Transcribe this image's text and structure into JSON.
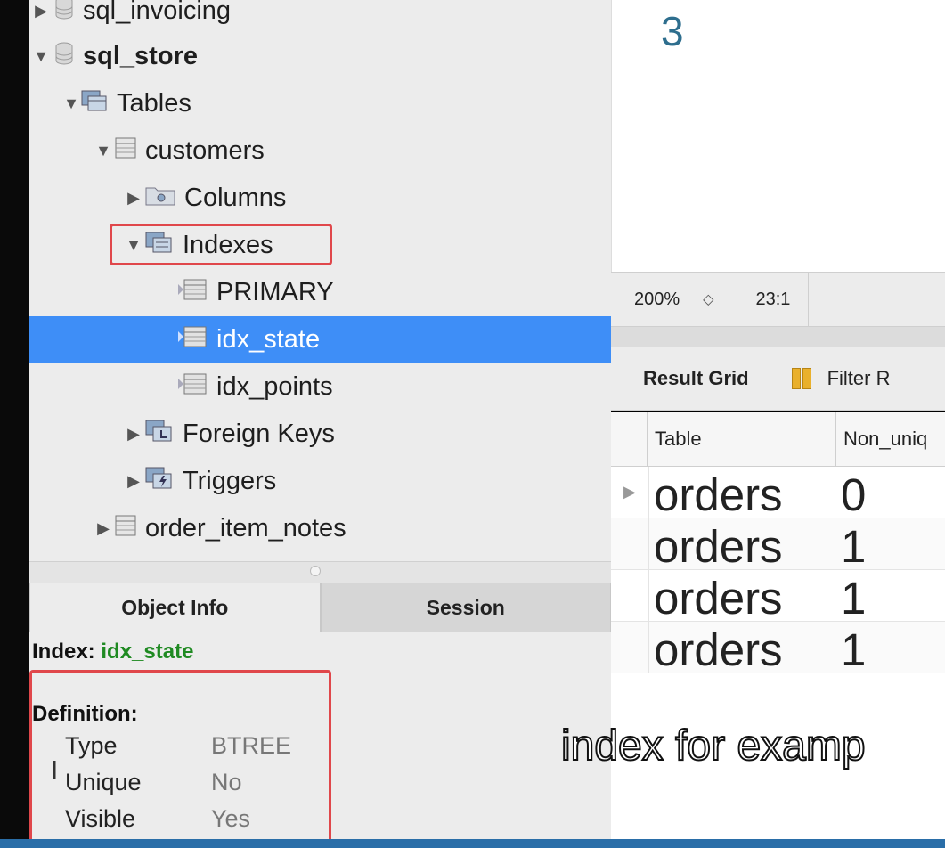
{
  "navigator": {
    "items": [
      {
        "label": "sql_invoicing",
        "icon": "database-icon",
        "arrow": "▶",
        "level": 0,
        "bold": false
      },
      {
        "label": "sql_store",
        "icon": "database-icon",
        "arrow": "▼",
        "level": 0,
        "bold": true
      },
      {
        "label": "Tables",
        "icon": "tables-folder-icon",
        "arrow": "▼",
        "level": 1,
        "bold": false
      },
      {
        "label": "customers",
        "icon": "table-icon",
        "arrow": "▼",
        "level": 2,
        "bold": false
      },
      {
        "label": "Columns",
        "icon": "columns-folder-icon",
        "arrow": "▶",
        "level": 3,
        "bold": false
      },
      {
        "label": "Indexes",
        "icon": "indexes-folder-icon",
        "arrow": "▼",
        "level": 3,
        "bold": false
      },
      {
        "label": "PRIMARY",
        "icon": "index-icon",
        "arrow": "",
        "level": 4,
        "bold": false
      },
      {
        "label": "idx_state",
        "icon": "index-icon",
        "arrow": "",
        "level": 4,
        "bold": false,
        "selected": true
      },
      {
        "label": "idx_points",
        "icon": "index-icon",
        "arrow": "",
        "level": 4,
        "bold": false
      },
      {
        "label": "Foreign Keys",
        "icon": "foreign-keys-folder-icon",
        "arrow": "▶",
        "level": 3,
        "bold": false
      },
      {
        "label": "Triggers",
        "icon": "triggers-folder-icon",
        "arrow": "▶",
        "level": 3,
        "bold": false
      },
      {
        "label": "order_item_notes",
        "icon": "table-icon",
        "arrow": "▶",
        "level": 2,
        "bold": false
      }
    ]
  },
  "info_tabs": {
    "object_info": "Object Info",
    "session": "Session"
  },
  "object_info": {
    "index_prefix": "Index:",
    "index_name": "idx_state",
    "definition_title": "Definition:",
    "properties": [
      {
        "key": "Type",
        "value": "BTREE"
      },
      {
        "key": "Unique",
        "value": "No"
      },
      {
        "key": "Visible",
        "value": "Yes"
      }
    ]
  },
  "editor": {
    "line_number": "3"
  },
  "status_bar": {
    "zoom": "200%",
    "cursor": "23:1"
  },
  "result_toolbar": {
    "result_grid": "Result Grid",
    "filter": "Filter R"
  },
  "result_grid": {
    "columns": [
      "Table",
      "Non_uniq"
    ],
    "rows": [
      [
        "orders",
        "0"
      ],
      [
        "orders",
        "1"
      ],
      [
        "orders",
        "1"
      ],
      [
        "orders",
        "1"
      ]
    ]
  },
  "caption": "index for examp",
  "colors": {
    "selection": "#3e8ef7",
    "highlight": "#e0474b",
    "index_name": "#1f8a22"
  }
}
